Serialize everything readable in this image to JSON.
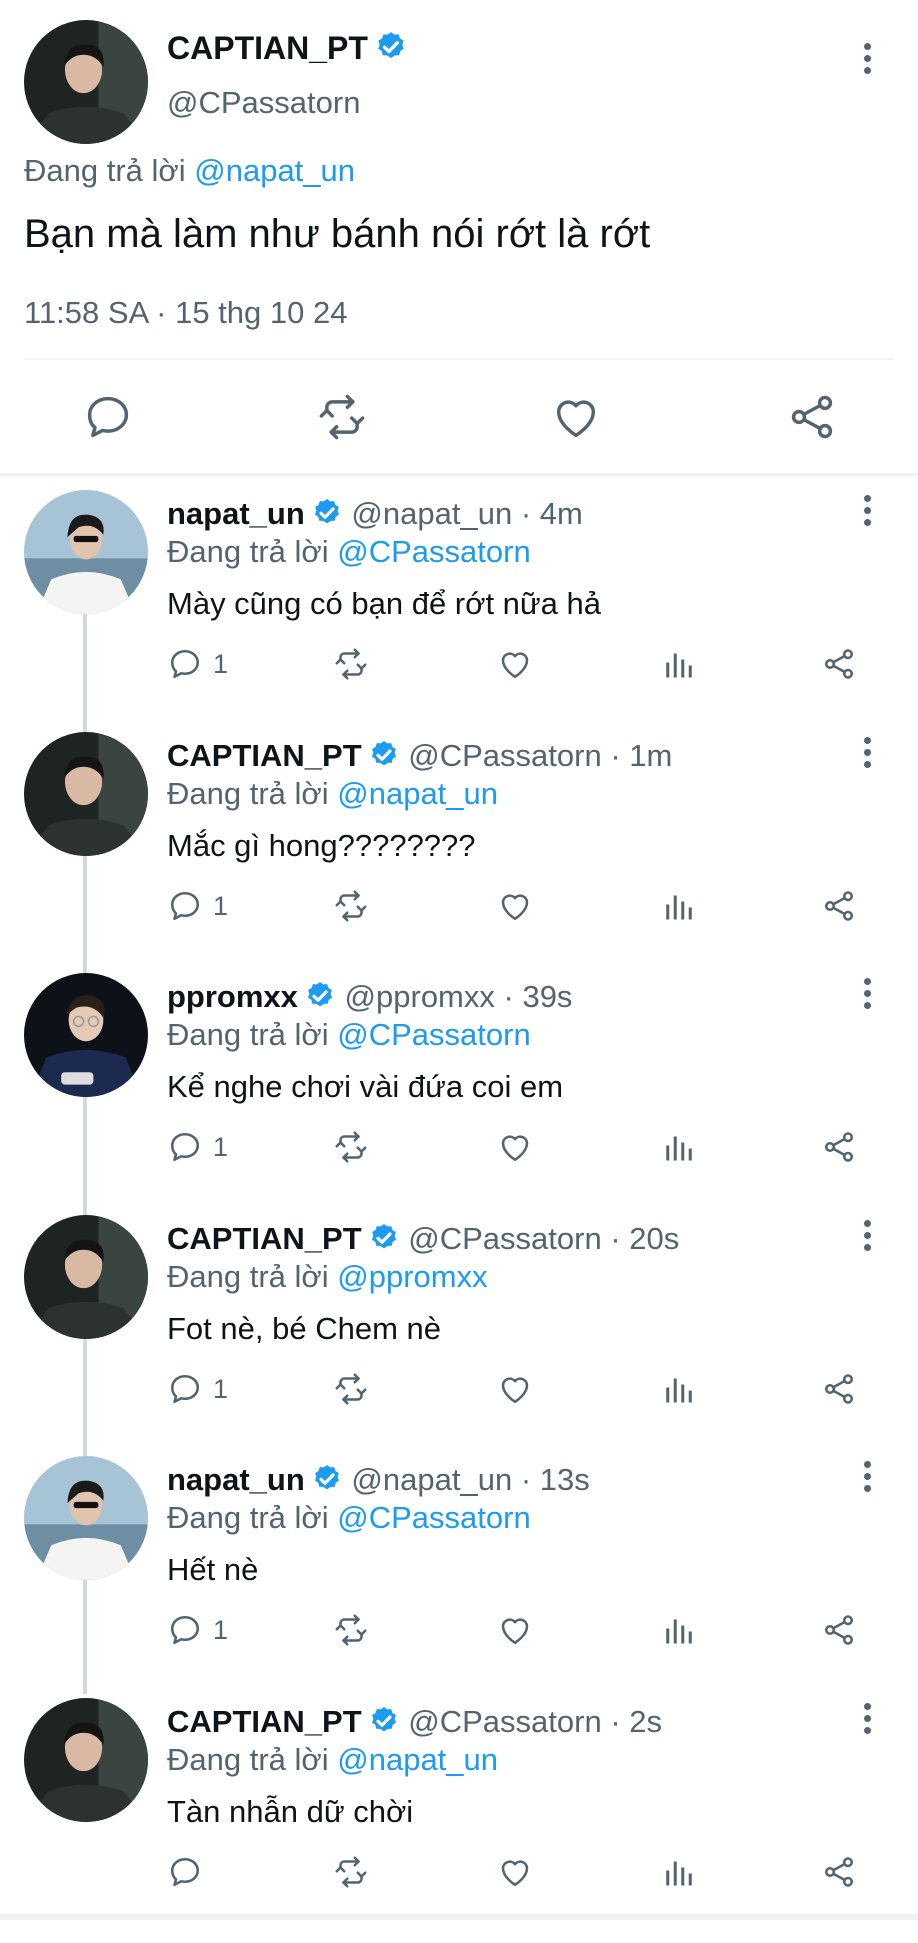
{
  "main_tweet": {
    "display_name": "CAPTIAN_PT",
    "handle": "@CPassatorn",
    "replying_label": "Đang trả lời",
    "replying_to": "@napat_un",
    "text": "Bạn mà làm như bánh nói rớt là rớt",
    "timestamp": "11:58 SA · 15 thg 10 24",
    "verified": true,
    "actions": [
      "reply-icon",
      "retweet-icon",
      "like-icon",
      "share-icon"
    ]
  },
  "replies": [
    {
      "display_name": "napat_un",
      "handle": "@napat_un",
      "time": "4m",
      "replying_label": "Đang trả lời",
      "replying_to": "@CPassatorn",
      "text": "Mày cũng có bạn để rớt nữa hả",
      "reply_count": "1"
    },
    {
      "display_name": "CAPTIAN_PT",
      "handle": "@CPassatorn",
      "time": "1m",
      "replying_label": "Đang trả lời",
      "replying_to": "@napat_un",
      "text": "Mắc gì hong????????",
      "reply_count": "1"
    },
    {
      "display_name": "ppromxx",
      "handle": "@ppromxx",
      "time": "39s",
      "replying_label": "Đang trả lời",
      "replying_to": "@CPassatorn",
      "text": "Kể nghe chơi vài đứa coi em",
      "reply_count": "1"
    },
    {
      "display_name": "CAPTIAN_PT",
      "handle": "@CPassatorn",
      "time": "20s",
      "replying_label": "Đang trả lời",
      "replying_to": "@ppromxx",
      "text": "Fot nè, bé Chem nè",
      "reply_count": "1"
    },
    {
      "display_name": "napat_un",
      "handle": "@napat_un",
      "time": "13s",
      "replying_label": "Đang trả lời",
      "replying_to": "@CPassatorn",
      "text": "Hết nè",
      "reply_count": "1"
    },
    {
      "display_name": "CAPTIAN_PT",
      "handle": "@CPassatorn",
      "time": "2s",
      "replying_label": "Đang trả lời",
      "replying_to": "@napat_un",
      "text": "Tàn nhẫn dữ chời",
      "reply_count": ""
    }
  ],
  "colors": {
    "accent": "#1d9bf0",
    "muted": "#536471",
    "text": "#0f1419",
    "divider": "#eff3f4"
  }
}
